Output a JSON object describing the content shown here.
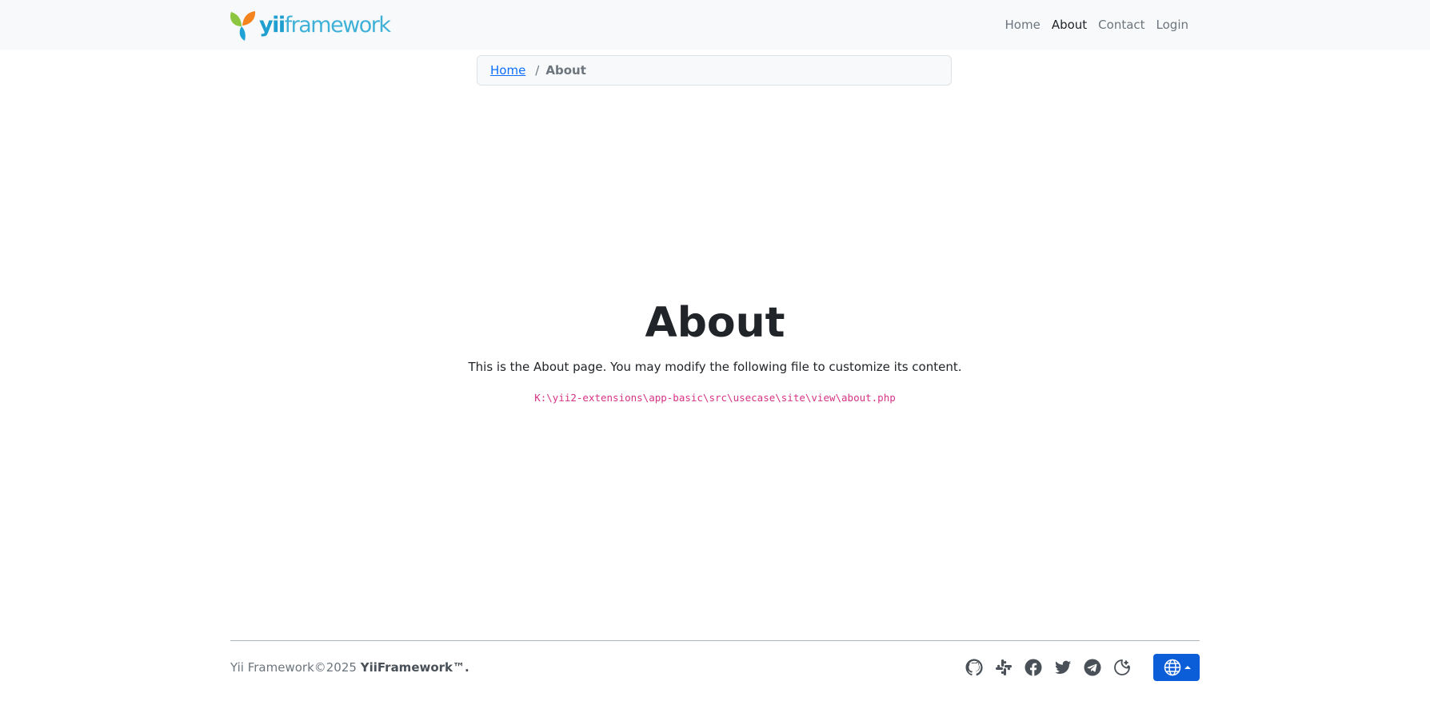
{
  "header": {
    "brand": {
      "part1": "yii",
      "part2": "framework"
    },
    "nav": [
      {
        "label": "Home",
        "active": false
      },
      {
        "label": "About",
        "active": true
      },
      {
        "label": "Contact",
        "active": false
      },
      {
        "label": "Login",
        "active": false
      }
    ]
  },
  "breadcrumb": {
    "home": "Home",
    "separator": "/",
    "current": "About"
  },
  "main": {
    "title": "About",
    "lead": "This is the About page. You may modify the following file to customize its content.",
    "path": "K:\\yii2-extensions\\app-basic\\src\\usecase\\site\\view\\about.php"
  },
  "footer": {
    "copyright": "Yii Framework©2025",
    "brand": "YiiFramework™.",
    "icons": [
      "github-icon",
      "slack-icon",
      "facebook-icon",
      "twitter-icon",
      "telegram-icon",
      "theme-toggle-icon"
    ],
    "language_icon": "globe-icon",
    "accent_color": "#0b5ed7"
  },
  "colors": {
    "navbar_bg": "#f8f9fa",
    "link": "#0d6efd",
    "code": "#d63384"
  }
}
